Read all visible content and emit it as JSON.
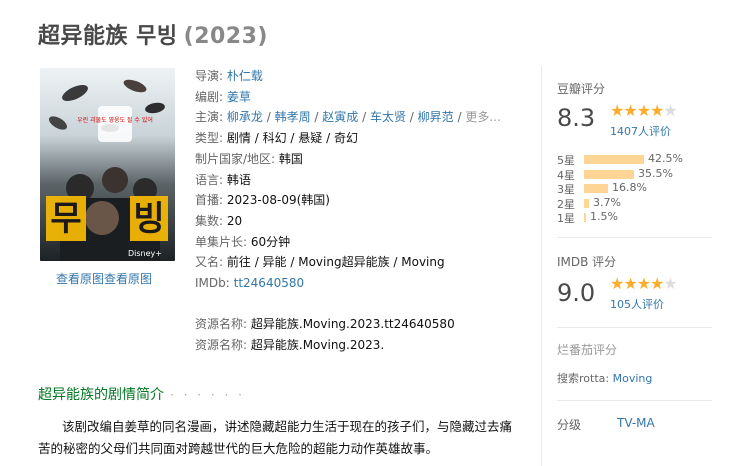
{
  "title": {
    "name": "超异能族 무빙",
    "year": "(2023)"
  },
  "poster": {
    "korean_title_a": "무",
    "korean_title_b": "빙",
    "tagline": "우린 괴물도 영웅도 될 수 있어",
    "brand": "Disney+",
    "links": [
      "查看原图",
      "查看原图"
    ]
  },
  "info": {
    "director_label": "导演:",
    "director": "朴仁载",
    "writer_label": "编剧:",
    "writer": "姜草",
    "cast_label": "主演:",
    "cast": [
      "柳承龙",
      "韩孝周",
      "赵寅成",
      "车太贤",
      "柳昇范"
    ],
    "cast_more": "更多...",
    "genre_label": "类型:",
    "genres": [
      "剧情",
      "科幻",
      "悬疑",
      "奇幻"
    ],
    "country_label": "制片国家/地区:",
    "country": "韩国",
    "language_label": "语言:",
    "language": "韩语",
    "premiere_label": "首播:",
    "premiere": "2023-08-09(韩国)",
    "episodes_label": "集数:",
    "episodes": "20",
    "runtime_label": "单集片长:",
    "runtime": "60分钟",
    "aka_label": "又名:",
    "aka": "前往 / 异能 / Moving超异能族 / Moving",
    "imdb_label": "IMDb:",
    "imdb": "tt24640580",
    "resource_label": "资源名称:",
    "resources": [
      "超异能族.Moving.2023.tt24640580",
      "超异能族.Moving.2023."
    ]
  },
  "douban": {
    "label": "豆瓣评分",
    "score": "8.3",
    "stars": 4,
    "count": "1407人评价",
    "breakdown": [
      {
        "label": "5星",
        "pct": 42.5,
        "text": "42.5%"
      },
      {
        "label": "4星",
        "pct": 35.5,
        "text": "35.5%"
      },
      {
        "label": "3星",
        "pct": 16.8,
        "text": "16.8%"
      },
      {
        "label": "2星",
        "pct": 3.7,
        "text": "3.7%"
      },
      {
        "label": "1星",
        "pct": 1.5,
        "text": "1.5%"
      }
    ],
    "star_color": "#ffac2d",
    "bar_color": "#ffd596"
  },
  "imdb_rating": {
    "label": "IMDB 评分",
    "score": "9.0",
    "stars": 4,
    "count": "105人评价"
  },
  "rotten": {
    "label": "烂番茄评分",
    "search_prefix": "搜索rotta:",
    "search_term": "Moving"
  },
  "classification": {
    "label": "分级",
    "value": "TV-MA"
  },
  "summary": {
    "heading": "超异能族的剧情简介",
    "dots": "· · · · · ·",
    "text": "该剧改编自姜草的同名漫画，讲述隐藏超能力生活于现在的孩子们，与隐藏过去痛苦的秘密的父母们共同面对跨越世代的巨大危险的超能力动作英雄故事。"
  },
  "colors": {
    "link": "#3377aa",
    "heading_green": "#007722",
    "title_gray": "#494949"
  }
}
